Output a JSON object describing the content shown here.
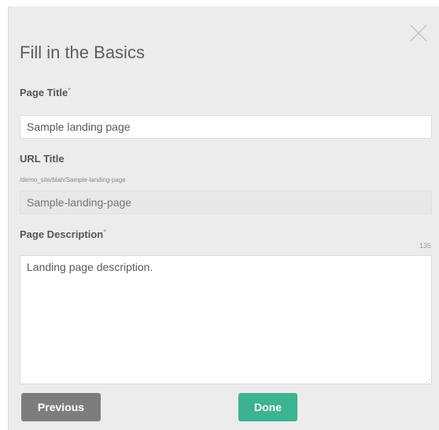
{
  "modal": {
    "title": "Fill in the Basics",
    "close_icon": "close-icon"
  },
  "page_title": {
    "label": "Page Title",
    "required_mark": "*",
    "value": "Sample landing page"
  },
  "url_title": {
    "label": "URL Title",
    "path": "/demo_site/blah/Sample-landing-page",
    "placeholder": "Sample-landing-page"
  },
  "page_description": {
    "label": "Page Description",
    "required_mark": "*",
    "counter": "135",
    "value": "Landing page description."
  },
  "buttons": {
    "previous": "Previous",
    "done": "Done"
  },
  "colors": {
    "done": "#3cb391",
    "previous": "#7d7d7d",
    "background": "#ececec"
  }
}
